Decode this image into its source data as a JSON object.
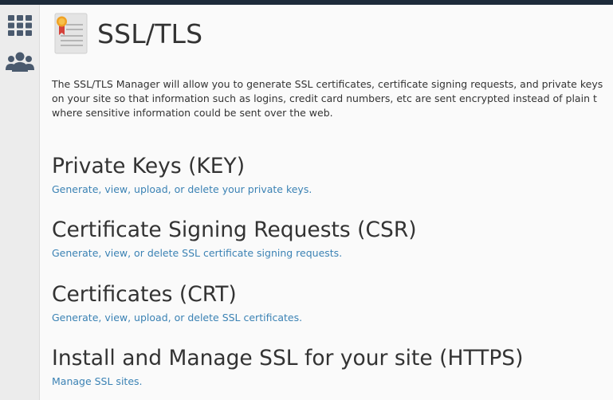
{
  "sidebar": {
    "items": [
      {
        "icon": "grid-icon",
        "label": ""
      },
      {
        "icon": "users-icon",
        "label": ""
      }
    ]
  },
  "page": {
    "title": "SSL/TLS",
    "icon": "certificate-icon",
    "description_lines": [
      "The SSL/TLS Manager will allow you to generate SSL certificates, certificate signing requests, and private keys",
      "on your site so that information such as logins, credit card numbers, etc are sent encrypted instead of plain t",
      "where sensitive information could be sent over the web."
    ]
  },
  "sections": [
    {
      "heading": "Private Keys (KEY)",
      "link": "Generate, view, upload, or delete your private keys."
    },
    {
      "heading": "Certificate Signing Requests (CSR)",
      "link": "Generate, view, or delete SSL certificate signing requests."
    },
    {
      "heading": "Certificates (CRT)",
      "link": "Generate, view, upload, or delete SSL certificates."
    },
    {
      "heading": "Install and Manage SSL for your site (HTTPS)",
      "link": "Manage SSL sites."
    }
  ],
  "colors": {
    "topbar": "#1d2b3a",
    "link": "#3b82b4",
    "text": "#333333",
    "icon": "#4a5a6e"
  }
}
